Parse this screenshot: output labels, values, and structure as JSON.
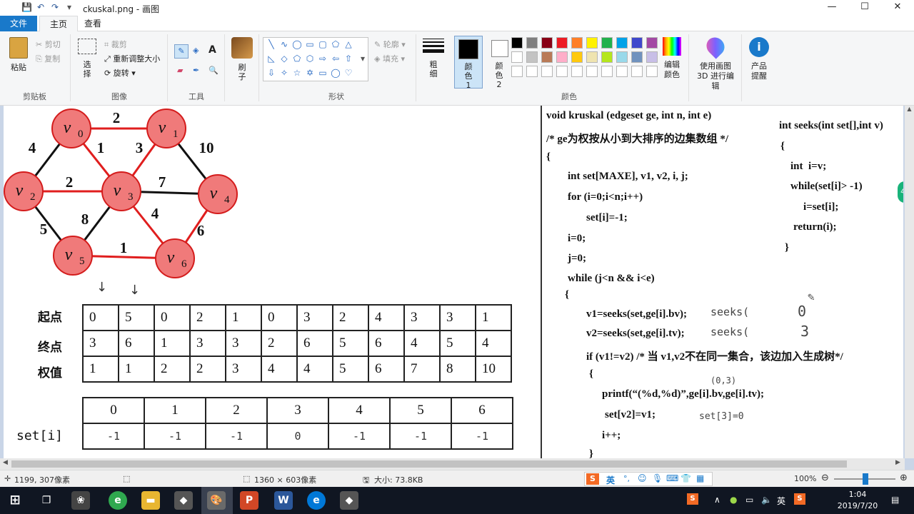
{
  "window": {
    "title": "ckuskal.png - 画图",
    "min": "—",
    "max": "☐",
    "close": "✕"
  },
  "tabs": {
    "file": "文件",
    "home": "主页",
    "view": "查看"
  },
  "ribbon": {
    "clipboard": {
      "paste": "粘贴",
      "cut": "剪切",
      "copy": "复制",
      "label": "剪贴板"
    },
    "image": {
      "select": "选择",
      "crop": "裁剪",
      "resize": "重新调整大小",
      "rotate": "旋转",
      "label": "图像"
    },
    "tools": {
      "label": "工具"
    },
    "brushes": {
      "label": "刷子"
    },
    "shapes": {
      "outline": "轮廓",
      "fill": "填充",
      "label": "形状"
    },
    "size": {
      "label": "粗细"
    },
    "colors": {
      "color1": "颜色 1",
      "color2": "颜色 2",
      "edit": "编辑颜色",
      "label": "颜色",
      "palette_row1": [
        "#000000",
        "#7f7f7f",
        "#880015",
        "#ed1c24",
        "#ff7f27",
        "#fff200",
        "#22b14c",
        "#00a2e8",
        "#3f48cc",
        "#a349a4"
      ],
      "palette_row2": [
        "#ffffff",
        "#c3c3c3",
        "#b97a57",
        "#ffaec9",
        "#ffc90e",
        "#efe4b0",
        "#b5e61d",
        "#99d9ea",
        "#7092be",
        "#c8bfe7"
      ]
    },
    "paint3d": "使用画图 3D 进行编辑",
    "product": "产品提醒"
  },
  "graph": {
    "vertices": [
      {
        "label": "v",
        "sub": "0"
      },
      {
        "label": "v",
        "sub": "1"
      },
      {
        "label": "v",
        "sub": "2"
      },
      {
        "label": "v",
        "sub": "3"
      },
      {
        "label": "v",
        "sub": "4"
      },
      {
        "label": "v",
        "sub": "5"
      },
      {
        "label": "v",
        "sub": "6"
      }
    ],
    "edge_weights": [
      "2",
      "4",
      "1",
      "3",
      "10",
      "2",
      "7",
      "8",
      "4",
      "5",
      "6",
      "1"
    ]
  },
  "edge_table": {
    "row_labels": [
      "起点",
      "终点",
      "权值"
    ],
    "start": [
      "0",
      "5",
      "0",
      "2",
      "1",
      "0",
      "3",
      "2",
      "4",
      "3",
      "3",
      "1"
    ],
    "end": [
      "3",
      "6",
      "1",
      "3",
      "3",
      "2",
      "6",
      "5",
      "6",
      "4",
      "5",
      "4"
    ],
    "weight": [
      "1",
      "1",
      "2",
      "2",
      "3",
      "4",
      "4",
      "5",
      "6",
      "7",
      "8",
      "10"
    ]
  },
  "set_table": {
    "label": "set[i]",
    "indices": [
      "0",
      "1",
      "2",
      "3",
      "4",
      "5",
      "6"
    ],
    "values": [
      "-1",
      "-1",
      "-1",
      "0",
      "-1",
      "-1",
      "-1"
    ]
  },
  "code": {
    "l1": "void kruskal (edgeset ge, int n, int e)",
    "l2": "/* ge为权按从小到大排序的边集数组 */",
    "l3": "{",
    "l4": "int set[MAXE], v1, v2, i, j;",
    "l5": "for (i=0;i<n;i++)",
    "l6": "set[i]=-1;",
    "l7": "i=0;",
    "l8": "j=0;",
    "l9": "while (j<n && i<e)",
    "l10": "{",
    "l11": "v1=seeks(set,ge[i].bv);",
    "l12": "v2=seeks(set,ge[i].tv);",
    "l13": "if (v1!=v2) /* 当 v1,v2不在同一集合，该边加入生成树*/",
    "l14": "{",
    "l15": "printf(“(%d,%d)”,ge[i].bv,ge[i].tv);",
    "l16": "set[v2]=v1;",
    "l17": "i++;",
    "l18": "}",
    "s1": "int seeks(int set[],int v)",
    "s2": "{",
    "s3": "int  i=v;",
    "s4": "while(set[i]> -1)",
    "s5": "i=set[i];",
    "s6": "return(i);",
    "s7": "}"
  },
  "annotations": {
    "a1": "seeks(",
    "a2": "0",
    "a3": "seeks(",
    "a4": "3",
    "a5": "(0,3)",
    "a6": "set[3]=0"
  },
  "status": {
    "cursor": "1199, 307像素",
    "dimensions": "1360 × 603像素",
    "filesize": "大小: 73.8KB",
    "zoom": "100%"
  },
  "tray": {
    "ime": "英",
    "time": "1:04",
    "date": "2019/7/20"
  }
}
